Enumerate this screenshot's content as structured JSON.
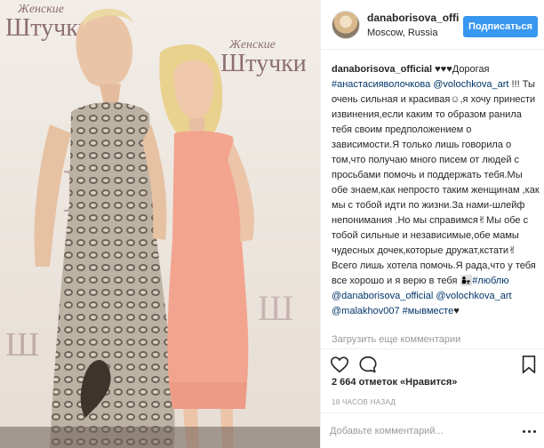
{
  "header": {
    "username": "danaborisova_offi",
    "location": "Moscow, Russia",
    "follow_label": "Подписаться"
  },
  "photo": {
    "banner_word_script": "Женские",
    "banner_word_main": "Штучки",
    "banner_word_script_2": "Женские",
    "banner_word_main_2": "Штучки"
  },
  "caption": {
    "author": "danaborisova_official",
    "text_1": " ♥♥♥Дорогая ",
    "tag_1": "#анастасияволочкова",
    "text_2": " ",
    "mention_1": "@volochkova_art",
    "text_3": " !!! Ты очень сильная и красивая☺,я хочу принести извинения,если каким то образом ранила тебя своим предположением о зависимости.Я только лишь говорила о том,что получаю много писем от людей с просьбами помочь и поддержать тебя.Мы обе знаем,как непросто таким женщинам ,как мы с тобой идти по жизни.За нами-шлейф непонимания .Но мы справимся✌Мы обе с тобой сильные и независимые,обе мамы чудесных дочек,которые дружат,кстати✌Всего лишь хотела помочь.Я рада,что у тебя все хорошо и я верю в тебя 👩‍👧",
    "tag_2": "#люблю",
    "text_4": " ",
    "mention_2": "@danaborisova_official",
    "text_5": " ",
    "mention_3": "@volochkova_art",
    "text_6": " ",
    "mention_4": "@malakhov007",
    "text_7": " ",
    "tag_3": "#мывместе",
    "text_8": "♥"
  },
  "load_more_label": "Загрузить еще комментарии",
  "likes_label": "2 664 отметок «Нравится»",
  "time_label": "18 ЧАСОВ НАЗАД",
  "comment": {
    "placeholder": "Добавьте комментарий..."
  },
  "icons": {
    "like": "heart-icon",
    "comment": "comment-icon",
    "save": "bookmark-icon",
    "more": "more-options-icon"
  },
  "colors": {
    "accent": "#3897f0",
    "link": "#003569",
    "muted": "#999999",
    "dress_coral": "#f2a48e"
  }
}
